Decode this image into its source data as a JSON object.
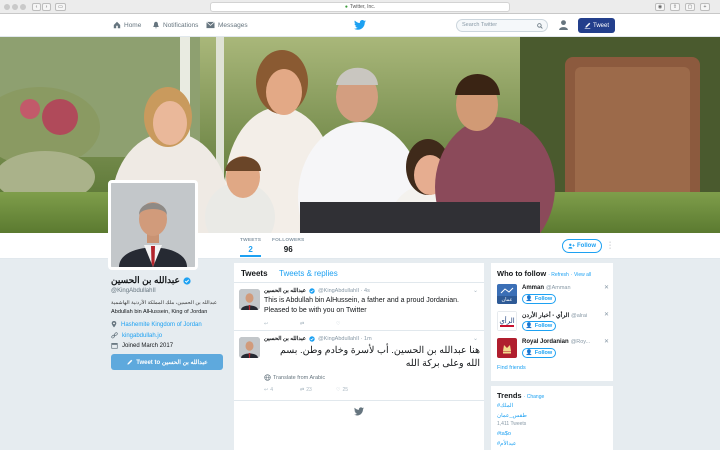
{
  "browser": {
    "url": "Twitter, Inc."
  },
  "nav": {
    "home": "Home",
    "notifications": "Notifications",
    "messages": "Messages",
    "search_placeholder": "Search Twitter",
    "tweet_button": "Tweet"
  },
  "profile": {
    "name": "عبدالله بن الحسين",
    "handle": "@KingAbdullahII",
    "bio_ar": "عبدالله بن الحسين، ملك المملكة الأردنية الهاشمية",
    "bio_en": "Abdullah bin AlHussein, King of Jordan",
    "location": "Hashemite Kingdom of Jordan",
    "website": "kingabdullah.jo",
    "joined": "Joined March 2017",
    "tweet_to": "Tweet to عبدالله بن الحسين"
  },
  "stats": {
    "tweets_label": "TWEETS",
    "tweets": "2",
    "followers_label": "FOLLOWERS",
    "followers": "96",
    "follow_button": "Follow"
  },
  "stream": {
    "tab_tweets": "Tweets",
    "tab_replies": "Tweets & replies",
    "tweets": [
      {
        "name": "عبدالله بن الحسين",
        "handle": "@KingAbdullahII · 4s",
        "text": "This is Abdullah bin AlHussein, a father and a proud Jordanian. Pleased to be with you on Twitter"
      },
      {
        "name": "عبدالله بن الحسين",
        "handle": "@KingAbdullahII · 1m",
        "text": "هنا عبدالله بن الحسين. أب لأسرة وخادم وطن. بسم الله وعلى بركة الله",
        "translate": "Translate from Arabic",
        "retweets": "4",
        "replies_count": "23",
        "likes": "25"
      }
    ]
  },
  "who_to_follow": {
    "title": "Who to follow",
    "refresh": "· Refresh",
    "view_all": "· View all",
    "follow_label": "Follow",
    "find_friends": "Find friends",
    "suggestions": [
      {
        "name": "Amman",
        "handle": "@Amman"
      },
      {
        "name": "الرأي - أخبار الأردن",
        "handle": "@alrai"
      },
      {
        "name": "Royal Jordanian",
        "handle": "@Roy..."
      }
    ]
  },
  "trends": {
    "title": "Trends",
    "change": "· Change",
    "items": [
      {
        "tag": "#الملك",
        "sub": ""
      },
      {
        "tag": "طقس_عمان",
        "sub": "1,411 Tweets"
      },
      {
        "tag": "#ta$o",
        "sub": ""
      },
      {
        "tag": "#عيدالأم",
        "sub": ""
      }
    ]
  },
  "colors": {
    "accent": "#1da1f2",
    "tweet_button": "#233f8c",
    "tweet_to_button": "#5ea9dd"
  }
}
